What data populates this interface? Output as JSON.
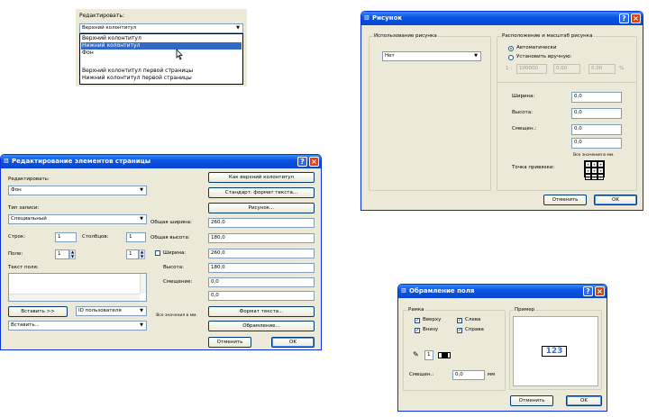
{
  "dropdown_panel": {
    "label": "Редактировать:",
    "selected": "Верхний колонтитул",
    "options": [
      "Верхний колонтитул",
      "Нижний колонтитул",
      "Фон",
      "Верхний колонтитул первой страницы",
      "Нижний колонтитул первой страницы"
    ],
    "highlighted_index": 1
  },
  "picture_dialog": {
    "title": "Рисунок",
    "usage_group": "Использование рисунка",
    "usage_value": "Нет",
    "placement_group": "Расположение и масштаб рисунка",
    "auto_label": "Автоматически",
    "manual_label": "Установить вручную:",
    "scale_prefix": "1 :",
    "scale_value": "100000",
    "scale_x": "0,00",
    "scale_sep": ":",
    "scale_y": "0,00",
    "scale_pct": "%",
    "width_label": "Ширина:",
    "width_value": "0,0",
    "height_label": "Высота:",
    "height_value": "0,0",
    "offset_label": "Смещен.:",
    "offset_value": "0,0",
    "offset_value2": "0,0",
    "units_note": "Все значения в мм.",
    "anchor_label": "Точка привязки:",
    "cancel": "Отменить",
    "ok": "OK"
  },
  "page_elements_dialog": {
    "title": "Редактирование элементов страницы",
    "edit_label": "Редактировать:",
    "edit_value": "Фон",
    "record_type_label": "Тип записи:",
    "record_type_value": "Специальный",
    "rows_label": "Строк:",
    "rows_value": "1",
    "cols_label": "Столбцов:",
    "cols_value": "1",
    "field_label": "Поле:",
    "field_value": "1",
    "field_value2": "1",
    "text_field_label": "Текст поля:",
    "insert_button": "Вставить >>",
    "user_id_value": "ID пользователя",
    "insert_combo": "Вставить...",
    "as_header_button": "Как верхний колонтитул",
    "std_format_button": "Стандарт. формат текста...",
    "picture_button": "Рисунок...",
    "total_width_label": "Общая ширина:",
    "total_width_value": "260,0",
    "total_height_label": "Общая высота:",
    "total_height_value": "180,0",
    "width_label": "Ширина:",
    "width_value": "260,0",
    "height_label": "Высота:",
    "height_value": "180,0",
    "offset_label": "Смещение:",
    "offset_value": "0,0",
    "offset_value2": "0,0",
    "units_note": "Все значения в мм.",
    "text_format_button": "Формат текста...",
    "border_button": "Обрамление...",
    "cancel": "Отменить",
    "ok": "OK"
  },
  "border_dialog": {
    "title": "Обрамление поля",
    "frame_group": "Рамка",
    "top_label": "Вверху",
    "left_label": "Слева",
    "bottom_label": "Внизу",
    "right_label": "Справа",
    "pen_value": "1",
    "offset_label": "Смещен.:",
    "offset_value": "0,0",
    "offset_unit": "мм",
    "sample_group": "Пример",
    "sample_text": "123",
    "cancel": "Отменить",
    "ok": "OK"
  }
}
